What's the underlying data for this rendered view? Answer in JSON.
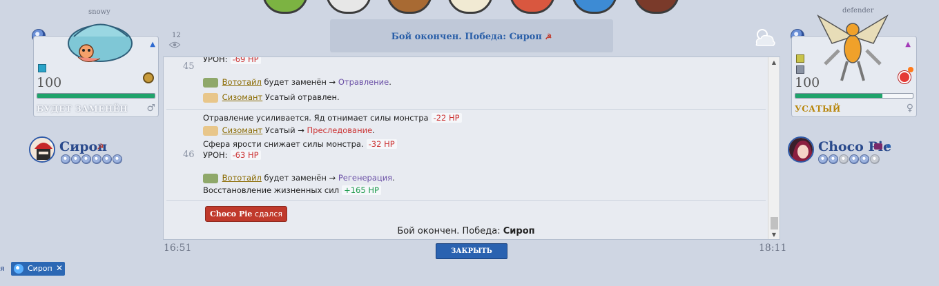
{
  "top_icons": [
    "bag-icon",
    "pokeball-icon",
    "backpack-icon",
    "mail-icon",
    "card-icon",
    "map-icon",
    "book-icon"
  ],
  "viewer_count": "12",
  "banner": {
    "text": "Бой окончен. Победа: Сироп"
  },
  "left": {
    "trainer_small": "snowy",
    "level": "100",
    "hp_fraction": 1.0,
    "poke_name": "БУДЕТ ЗАМЕНЁН",
    "gender": "♂",
    "trainer_name": "Сироп",
    "balls_remaining": 6
  },
  "right": {
    "trainer_small": "defender",
    "level": "100",
    "hp_fraction": 0.74,
    "poke_name": "УСАТЫЙ",
    "gender": "♀",
    "trainer_name": "Choco Pie",
    "balls": [
      "active",
      "active",
      "out",
      "active",
      "active",
      "out"
    ]
  },
  "log": {
    "turn45": {
      "num": "45",
      "dmg_label": "УРОН:",
      "dmg": "-69 HP",
      "l2_poke": "Вототайл",
      "l2_text": "будет заменён →",
      "l2_status": "Отравление",
      "l2_end": ".",
      "l3_poke": "Сизомант",
      "l3_text": "Усатый отравлен."
    },
    "turn46": {
      "num": "46",
      "l1_text": "Отравление усиливается. Яд отнимает силы монстра",
      "l1_dmg": "-22 HP",
      "l2_poke": "Сизомант",
      "l2_text": "Усатый →",
      "l2_status": "Преследование",
      "l2_end": ".",
      "l3_text": "Сфера ярости снижает силы монстра.",
      "l3_dmg": "-32 HP",
      "l4_label": "УРОН:",
      "l4_dmg": "-63 HP",
      "l5_poke": "Вототайл",
      "l5_text": "будет заменён →",
      "l5_status": "Регенерация",
      "l5_end": ".",
      "l6_text": "Восстановление жизненных сил",
      "l6_heal": "+165 HP"
    },
    "surrender_name": "Choco Pie",
    "surrender_text": "сдался",
    "end_prefix": "Бой окончен. Победа:",
    "end_winner": "Сироп"
  },
  "time_start": "16:51",
  "time_end": "18:11",
  "close_label": "ЗАКРЫТЬ",
  "footer": {
    "left_tab": "я",
    "chip_label": "Сироп"
  },
  "colors": {
    "accent": "#2a62b0",
    "hp": "#1fa36b",
    "damage": "#cc3333",
    "heal": "#1a9a4a"
  }
}
